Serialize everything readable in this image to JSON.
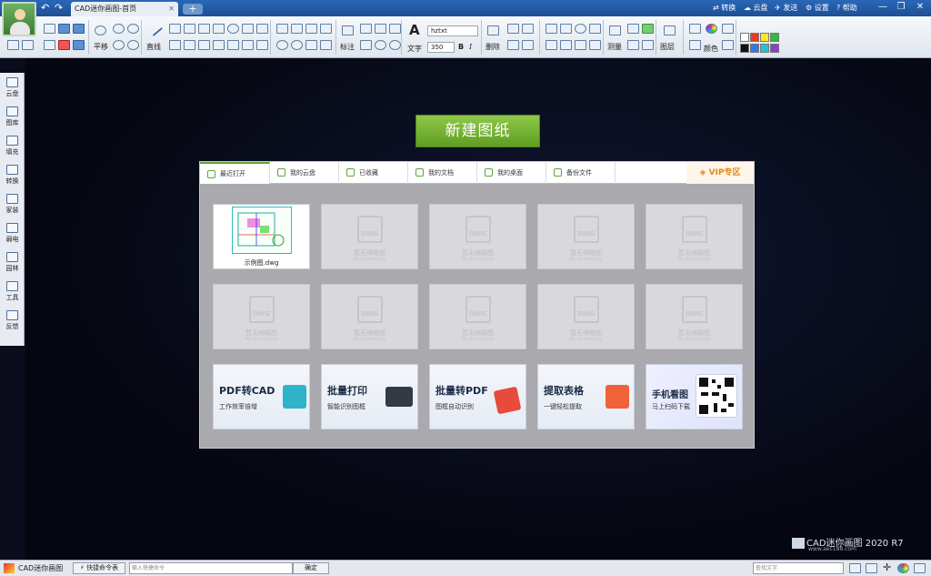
{
  "window": {
    "title": "CAD迷你画图-首页",
    "add_tab": "+"
  },
  "title_actions": [
    {
      "label": "转换",
      "icon": "convert-icon"
    },
    {
      "label": "云盘",
      "icon": "cloud-icon"
    },
    {
      "label": "发送",
      "icon": "send-icon"
    },
    {
      "label": "设置",
      "icon": "gear-icon"
    },
    {
      "label": "帮助",
      "icon": "help-icon"
    }
  ],
  "window_controls": {
    "minimize": "—",
    "restore": "❐",
    "close": "✕"
  },
  "ribbon": {
    "pan": "平移",
    "line": "直线",
    "dimension": "标注",
    "text": "文字",
    "font_name": "hztxt",
    "font_size": "350",
    "bold": "B",
    "italic": "I",
    "delete": "删除",
    "measure": "测量",
    "layer": "图层",
    "color": "颜色",
    "swatches": [
      "#ffffff",
      "#e83a2a",
      "#f1ea27",
      "#2fbd3a",
      "#111111",
      "#2c7be5",
      "#27c0d5",
      "#8a3fc9"
    ]
  },
  "leftbar": [
    "云盘",
    "图库",
    "填充",
    "转换",
    "家装",
    "弱电",
    "园林",
    "工具",
    "反馈"
  ],
  "canvas": {
    "new_drawing": "新建图纸"
  },
  "panel": {
    "tabs": [
      "最近打开",
      "我的云盘",
      "已收藏",
      "我的文档",
      "我的桌面",
      "备份文件"
    ],
    "vip": "VIP专区",
    "sample_file": "示例图.dwg",
    "empty_label": "暂无缩略图",
    "empty_sub": "No thumbnails",
    "dwg": "DWG",
    "features": [
      {
        "title": "PDF转CAD",
        "sub": "工作效率倍增",
        "color": "#2fb3c9"
      },
      {
        "title": "批量打印",
        "sub": "智能识别图框",
        "color": "#333a44"
      },
      {
        "title": "批量转PDF",
        "sub": "图框自动识别",
        "color": "#e64b3b"
      },
      {
        "title": "提取表格",
        "sub": "一键轻松提取",
        "color": "#f0623a"
      },
      {
        "title": "手机看图",
        "sub": "马上扫码下载",
        "color": "#ffffff"
      }
    ]
  },
  "brand": {
    "name": "CAD迷你画图",
    "version": "2020 R7",
    "site": "www.aec188.com"
  },
  "statusbar": {
    "app": "CAD迷你画图",
    "shortcut": "快捷命令表",
    "cmd_placeholder": "输入快捷命令",
    "confirm": "确定",
    "search_placeholder": "查找文字"
  }
}
